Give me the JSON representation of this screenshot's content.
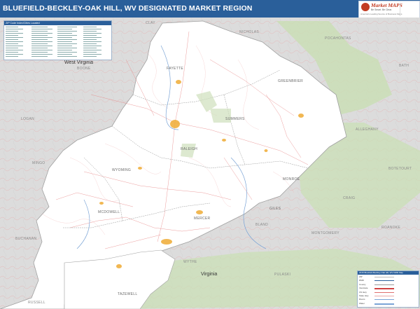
{
  "title": "BLUEFIELD-BECKLEY-OAK HILL, WV DESIGNATED MARKET REGION",
  "logo": {
    "brand": "Market MAPS",
    "tagline": "Be Smart. Be Clear.",
    "tagline2": "America's Leading Source of Business Maps"
  },
  "zip_index": {
    "title": "ZIP Code Index/Cities Located"
  },
  "legend": {
    "title": "2015 Bluefield-Beckley-Oak Hill, WV DMR Map",
    "rows": [
      "ZIP",
      "DMR",
      "County",
      "Interstate",
      "US Hwy",
      "State Hwy",
      "Rivers",
      "Water"
    ]
  },
  "states": {
    "west_virginia": "West Virginia",
    "virginia": "Virginia"
  },
  "counties_in_region": [
    "FAYETTE",
    "GREENBRIER",
    "RALEIGH",
    "SUMMERS",
    "MONROE",
    "WYOMING",
    "MERCER",
    "MCDOWELL",
    "TAZEWELL",
    "GILES"
  ],
  "counties_outside": [
    "NICHOLAS",
    "POCAHONTAS",
    "BATH",
    "BOONE",
    "LOGAN",
    "MINGO",
    "ALLEGHANY",
    "BOTETOURT",
    "CRAIG",
    "BLAND",
    "MONTGOMERY",
    "BUCHANAN",
    "RUSSELL",
    "WYTHE",
    "PULASKI",
    "ROANOKE",
    "CLAY"
  ],
  "colors": {
    "title_bar": "#2a5f9a",
    "region_fill": "#ffffff",
    "outside_fill": "#dcdcdc",
    "forest": "#c9dfb4",
    "urban": "#f0b040",
    "water": "#7ba4d6",
    "roads": "#e07070"
  }
}
